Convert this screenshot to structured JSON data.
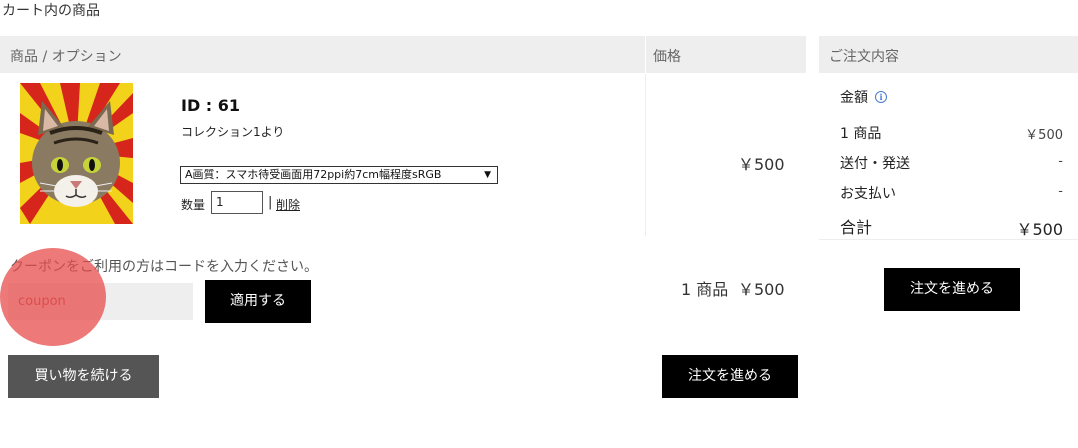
{
  "page_title": "カート内の商品",
  "cart_table": {
    "header_product": "商品 / オプション",
    "header_price": "価格"
  },
  "item": {
    "id_label": "ID : 61",
    "collection": "コレクション1より",
    "option_selected": "A画質：スマホ待受画面用72ppi約7cm幅程度sRGB",
    "quantity_label": "数量",
    "quantity_value": "1",
    "separator": "|",
    "delete_label": "削除",
    "price": "￥500",
    "thumbnail_icon": "cat-portrait-image"
  },
  "coupon": {
    "prompt": "クーポンをご利用の方はコードを入力ください。",
    "placeholder": "coupon",
    "apply_label": "適用する"
  },
  "subtotal": {
    "items": "1 商品",
    "price": "￥500"
  },
  "actions": {
    "continue_shopping": "買い物を続ける",
    "proceed_checkout": "注文を進める"
  },
  "summary": {
    "header": "ご注文内容",
    "amount_label": "金額",
    "info_icon": "info-icon",
    "rows": [
      {
        "label": "1 商品",
        "value": "￥500"
      },
      {
        "label": "送付・発送",
        "value": "-"
      },
      {
        "label": "お支払い",
        "value": "-"
      }
    ],
    "total_label": "合計",
    "total_value": "￥500",
    "checkout_label": "注文を進める"
  },
  "colors": {
    "header_bg": "#eeeeee",
    "primary_button": "#000000",
    "secondary_button": "#555555",
    "touch_marker": "#e74c4c"
  }
}
